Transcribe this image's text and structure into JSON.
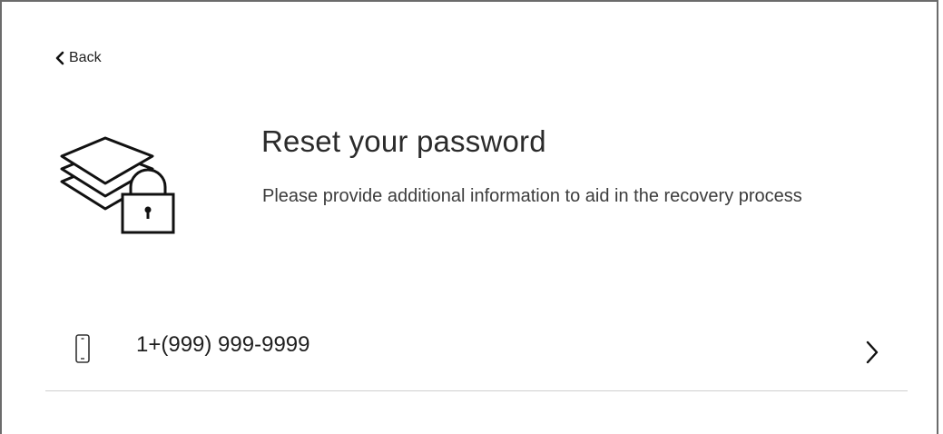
{
  "nav": {
    "back_label": "Back"
  },
  "header": {
    "title": "Reset your password",
    "subtitle": "Please provide additional information to aid in the recovery process",
    "hero_icon": "layers-lock-icon"
  },
  "recovery_options": [
    {
      "icon": "mobile-phone-icon",
      "value": "1+(999) 999-9999",
      "action_icon": "chevron-right-icon"
    }
  ],
  "colors": {
    "text": "#1f1f1f",
    "divider": "#cfcfcf",
    "frame_border": "#6b6b6b"
  }
}
